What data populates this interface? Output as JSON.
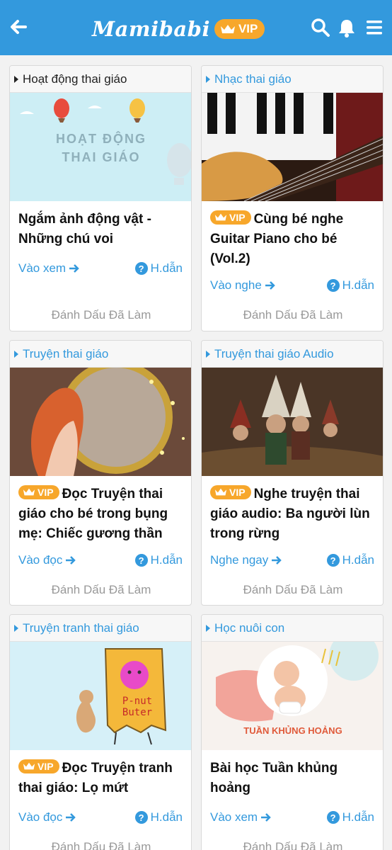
{
  "header": {
    "logo_text": "Mamibabi",
    "vip_label": "VIP"
  },
  "cards": [
    {
      "category": "Hoạt động thai giáo",
      "vip": false,
      "title": "Ngắm ảnh động vật - Những chú voi",
      "action": "Vào xem",
      "help": "H.dẫn",
      "mark": "Đánh Dấu Đã Làm",
      "thumb_text_1": "HOẠT ĐỘNG",
      "thumb_text_2": "THAI GIÁO"
    },
    {
      "category": "Nhạc thai giáo",
      "vip": true,
      "vip_label": "VIP",
      "title": "Cùng bé nghe Guitar Piano cho bé (Vol.2)",
      "action": "Vào nghe",
      "help": "H.dẫn",
      "mark": "Đánh Dấu Đã Làm"
    },
    {
      "category": "Truyện thai giáo",
      "vip": true,
      "vip_label": "VIP",
      "title": "Đọc Truyện thai giáo cho bé trong bụng mẹ: Chiếc gương thần",
      "action": "Vào đọc",
      "help": "H.dẫn",
      "mark": "Đánh Dấu Đã Làm"
    },
    {
      "category": "Truyện thai giáo Audio",
      "vip": true,
      "vip_label": "VIP",
      "title": "Nghe truyện thai giáo audio: Ba người lùn trong rừng",
      "action": "Nghe ngay",
      "help": "H.dẫn",
      "mark": "Đánh Dấu Đã Làm"
    },
    {
      "category": "Truyện tranh thai giáo",
      "vip": true,
      "vip_label": "VIP",
      "title": "Đọc Truyện tranh thai giáo: Lọ mứt",
      "action": "Vào đọc",
      "help": "H.dẫn",
      "mark": "Đánh Dấu Đã Làm",
      "thumb_text_1": "P-nut",
      "thumb_text_2": "Buter"
    },
    {
      "category": "Học nuôi con",
      "vip": false,
      "title": "Bài học Tuần khủng hoảng",
      "action": "Vào xem",
      "help": "H.dẫn",
      "mark": "Đánh Dấu Đã Làm",
      "thumb_text_1": "TUẦN KHỦNG HOẢNG"
    }
  ],
  "colors": {
    "brand": "#3399dd",
    "vip": "#f7a72b",
    "muted": "#999999"
  },
  "icons": [
    "back-arrow-icon",
    "crown-icon",
    "search-icon",
    "bell-icon",
    "menu-icon",
    "arrow-right-icon",
    "question-icon"
  ]
}
